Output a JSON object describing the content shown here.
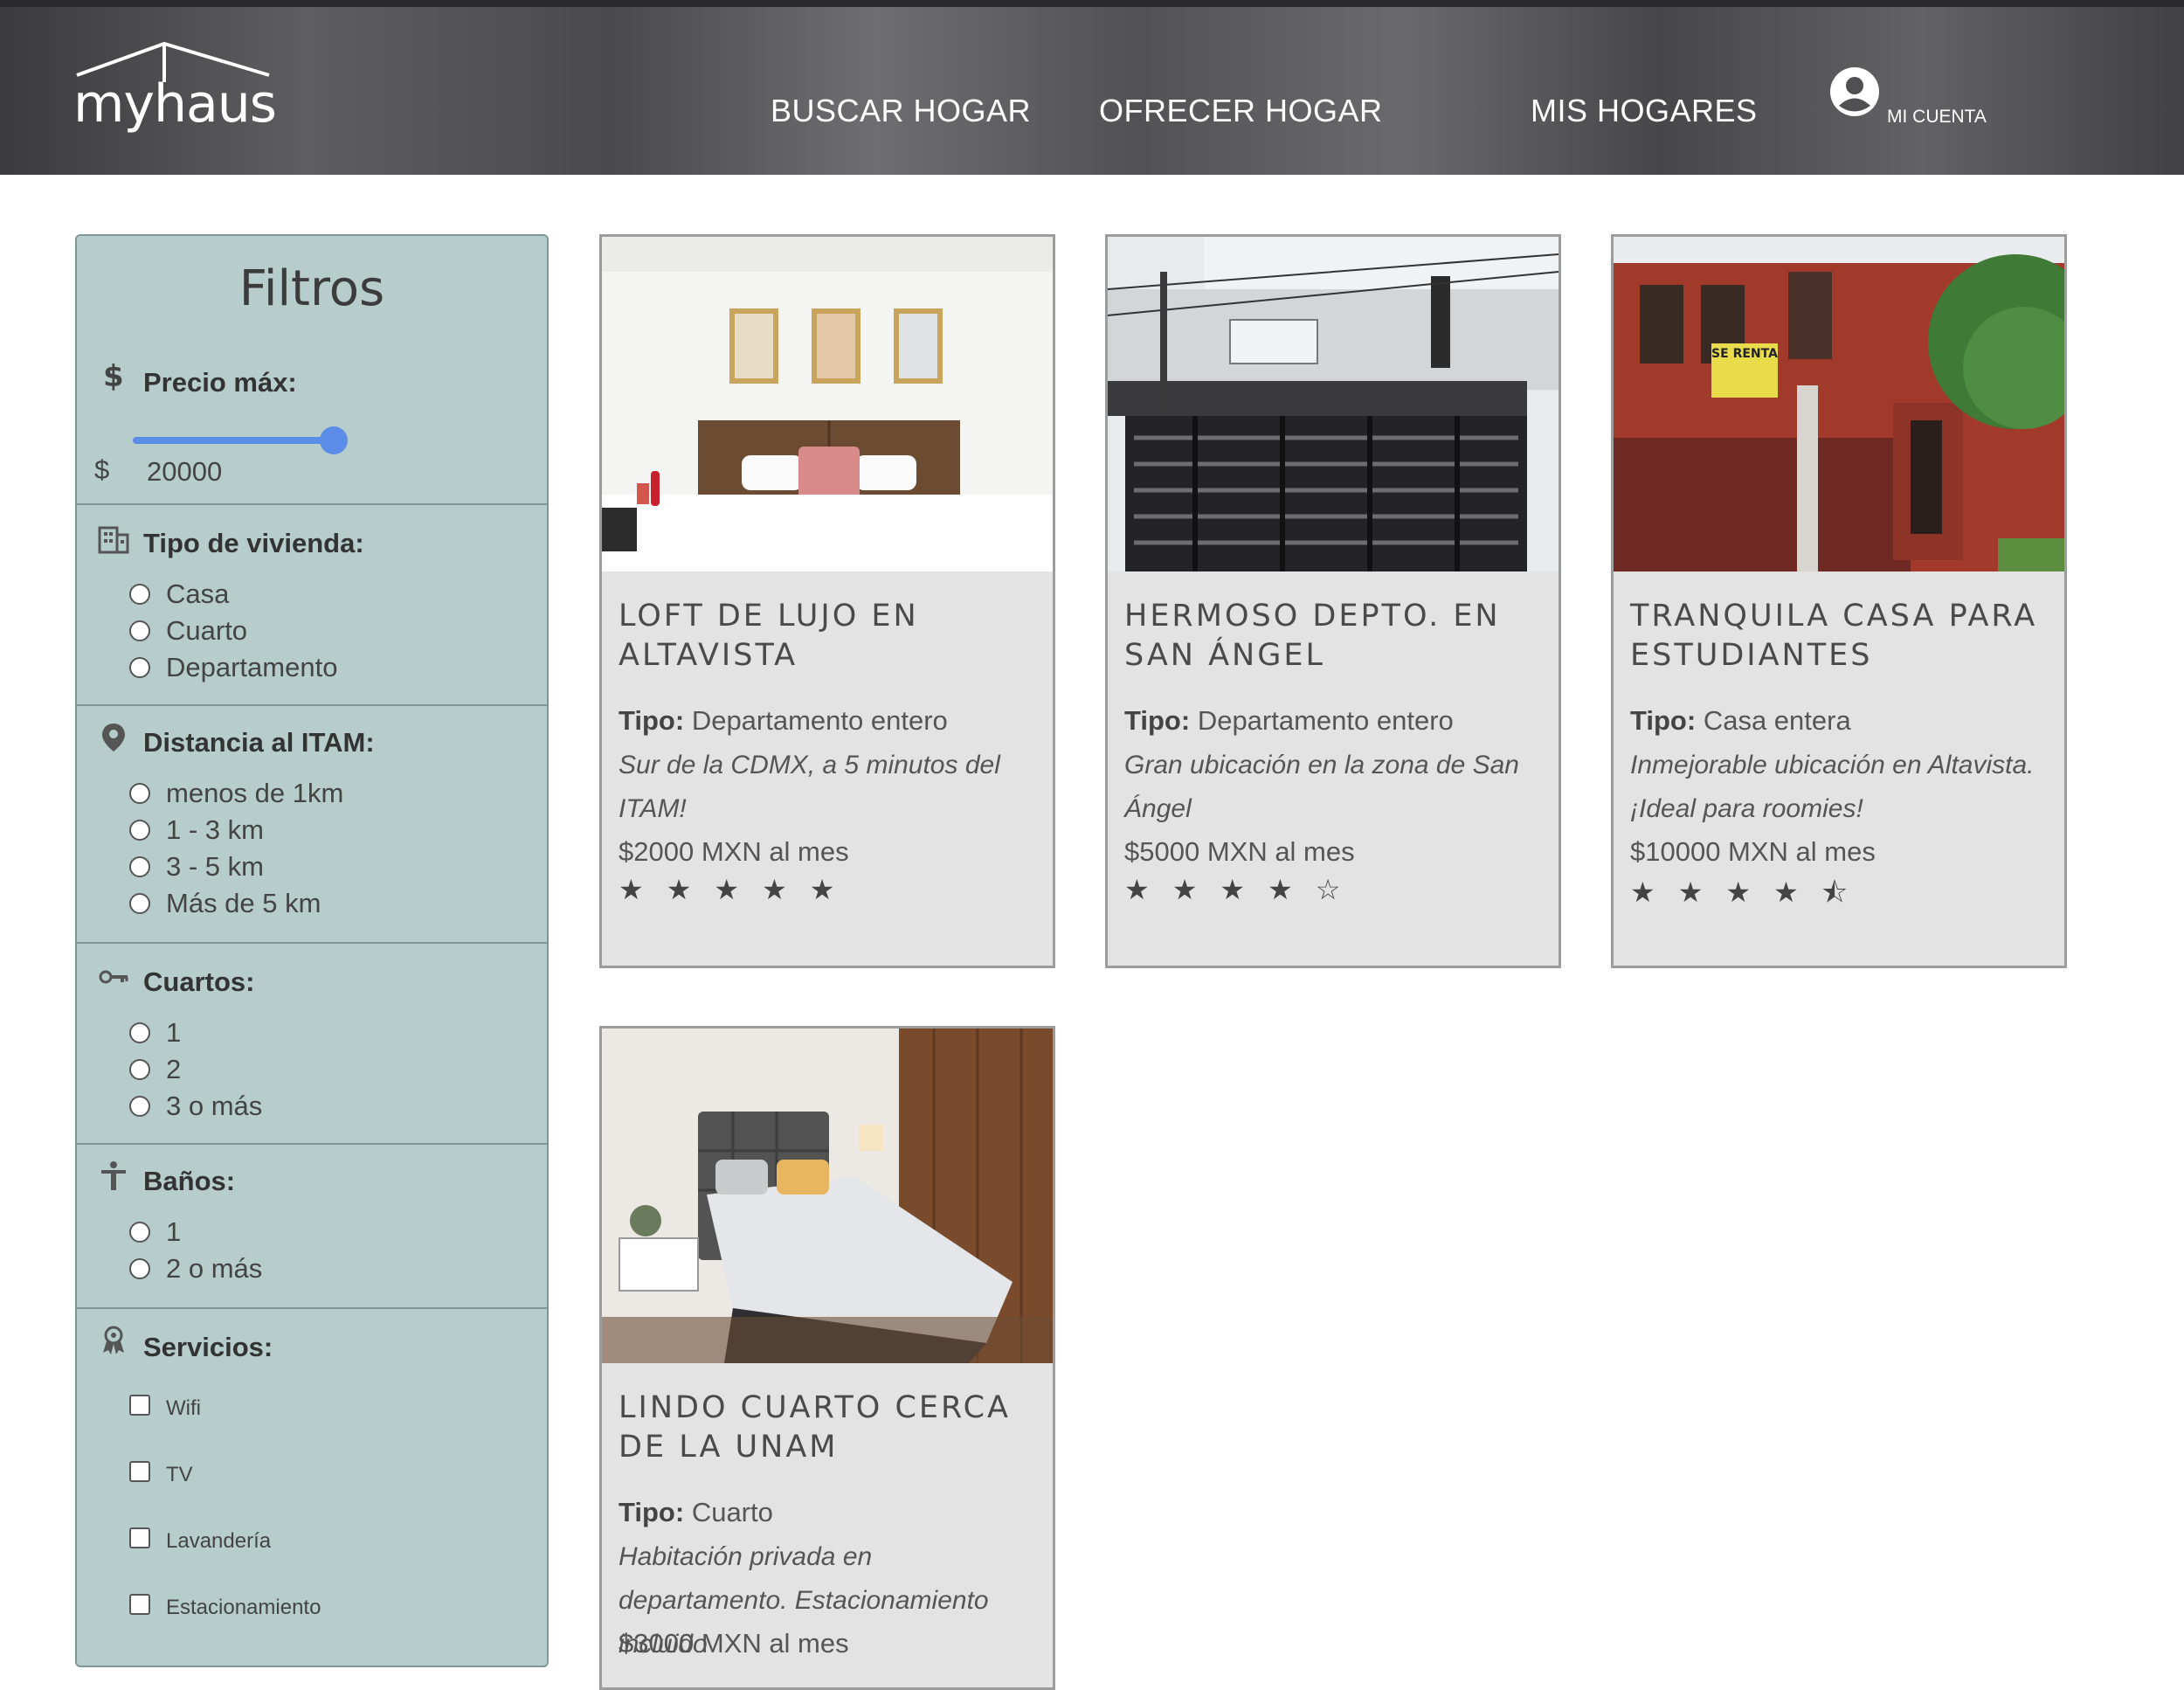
{
  "header": {
    "logo_text": "myhaus",
    "nav": [
      "BUSCAR HOGAR",
      "OFRECER HOGAR",
      "MIS HOGARES"
    ],
    "account_label": "MI CUENTA"
  },
  "filters": {
    "title": "Filtros",
    "price": {
      "label": "Precio máx:",
      "currency": "$",
      "value": "20000",
      "slider_fraction": 1.0
    },
    "housing_type": {
      "label": "Tipo de vivienda:",
      "options": [
        "Casa",
        "Cuarto",
        "Departamento"
      ]
    },
    "distance": {
      "label": "Distancia al ITAM:",
      "options": [
        "menos de 1km",
        "1 - 3 km",
        "3 - 5 km",
        "Más de 5 km"
      ]
    },
    "rooms": {
      "label": "Cuartos:",
      "options": [
        "1",
        "2",
        "3 o más"
      ]
    },
    "baths": {
      "label": "Baños:",
      "options": [
        "1",
        "2 o más"
      ]
    },
    "services": {
      "label": "Servicios:",
      "options": [
        "Wifi",
        "TV",
        "Lavandería",
        "Estacionamiento"
      ]
    }
  },
  "listings": [
    {
      "title": "LOFT DE LUJO EN ALTAVISTA",
      "type_label": "Tipo:",
      "type": "Departamento entero",
      "description": "Sur de la CDMX, a 5 minutos del ITAM!",
      "price": "$2000 MXN al mes",
      "rating": 5
    },
    {
      "title": "HERMOSO DEPTO. EN SAN ÁNGEL",
      "type_label": "Tipo:",
      "type": "Departamento entero",
      "description": "Gran ubicación en la zona de San Ángel",
      "price": "$5000 MXN al mes",
      "rating": 4
    },
    {
      "title": "TRANQUILA CASA PARA ESTUDIANTES",
      "type_label": "Tipo:",
      "type": "Casa entera",
      "description": "Inmejorable ubicación en Altavista. ¡Ideal para roomies!",
      "price": "$10000 MXN al mes",
      "rating": 4.5
    },
    {
      "title": "LINDO CUARTO CERCA DE LA UNAM",
      "type_label": "Tipo:",
      "type": "Cuarto",
      "description": "Habitación privada en departamento. Estacionamiento incluido",
      "price": "$3000 MXN al mes",
      "rating": null
    }
  ],
  "images": {
    "sign_text": "SE RENTA"
  }
}
